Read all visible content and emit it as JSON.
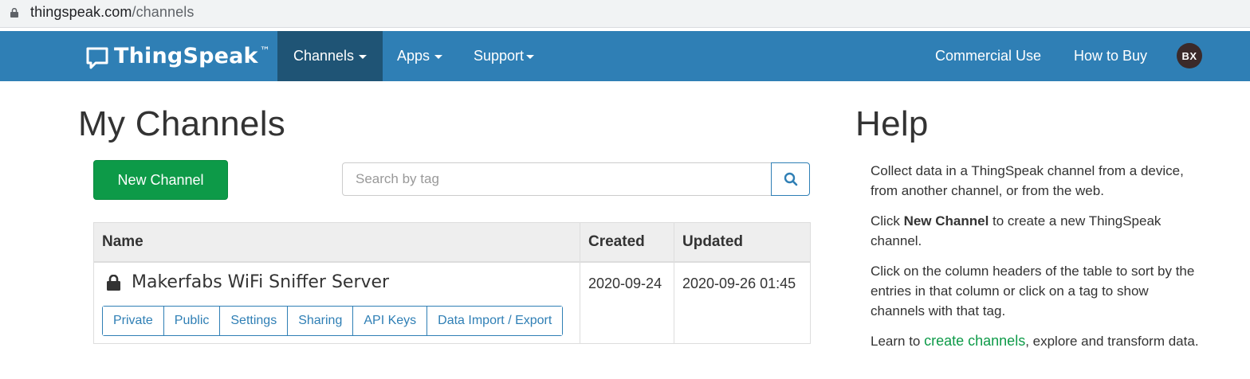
{
  "browser": {
    "url_host": "thingspeak.com",
    "url_path": "/channels"
  },
  "navbar": {
    "brand": "ThingSpeak",
    "brand_tm": "™",
    "items": [
      {
        "label": "Channels",
        "active": true
      },
      {
        "label": "Apps"
      },
      {
        "label": "Support"
      }
    ],
    "right_items": [
      {
        "label": "Commercial Use"
      },
      {
        "label": "How to Buy"
      }
    ],
    "avatar_initials": "BX"
  },
  "page": {
    "title": "My Channels",
    "new_channel_label": "New Channel",
    "search_placeholder": "Search by tag"
  },
  "table": {
    "headers": [
      "Name",
      "Created",
      "Updated"
    ],
    "rows": [
      {
        "name": "Makerfabs WiFi Sniffer Server",
        "created": "2020-09-24",
        "updated": "2020-09-26 01:45",
        "actions": [
          "Private",
          "Public",
          "Settings",
          "Sharing",
          "API Keys",
          "Data Import / Export"
        ]
      }
    ]
  },
  "help": {
    "title": "Help",
    "p1": "Collect data in a ThingSpeak channel from a device, from another channel, or from the web.",
    "p2_pre": "Click ",
    "p2_bold": "New Channel",
    "p2_post": " to create a new ThingSpeak channel.",
    "p3": "Click on the column headers of the table to sort by the entries in that column or click on a tag to show channels with that tag.",
    "p4_pre": "Learn to ",
    "p4_link": "create channels",
    "p4_post": ", explore and transform data."
  },
  "colors": {
    "navbar": "#2f7fb5",
    "navbar_active": "#1f5475",
    "primary_green": "#0d9a48",
    "link_blue": "#2f7fb5"
  }
}
